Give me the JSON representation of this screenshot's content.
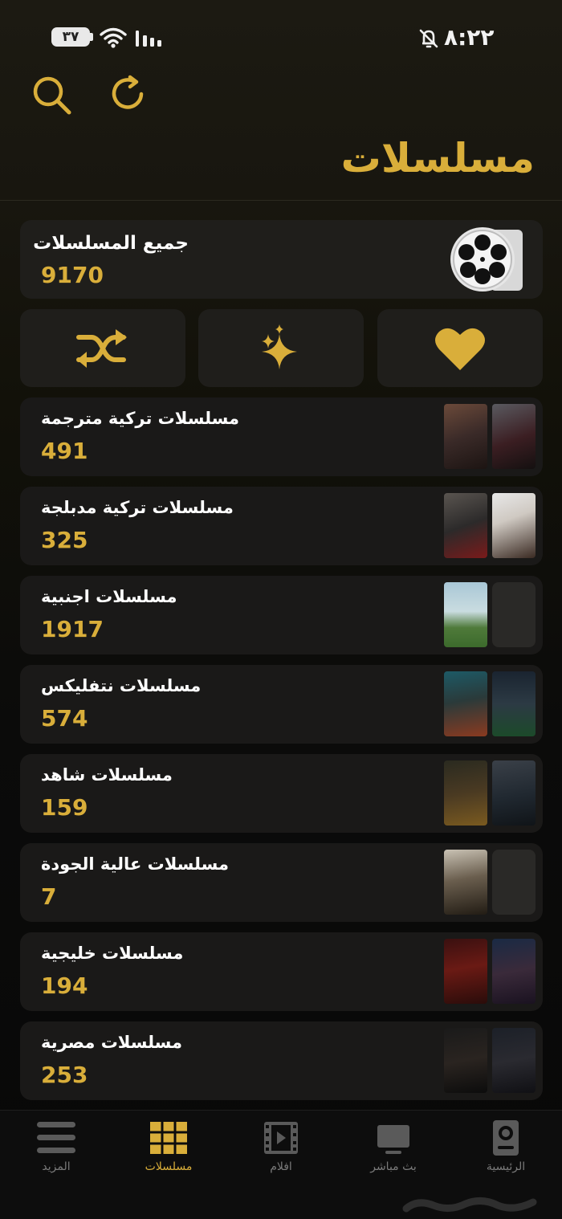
{
  "status_bar": {
    "time": "٨:٢٢",
    "battery": "٣٧"
  },
  "header": {
    "title": "مسلسلات"
  },
  "all_series": {
    "label": "جميع المسلسلات",
    "count": "9170"
  },
  "actions": [
    {
      "name": "shuffle",
      "icon": "shuffle-icon"
    },
    {
      "name": "featured",
      "icon": "sparkles-icon"
    },
    {
      "name": "favorites",
      "icon": "heart-icon"
    }
  ],
  "categories": [
    {
      "label": "مسلسلات تركية مترجمة",
      "count": "491"
    },
    {
      "label": "مسلسلات تركية مدبلجة",
      "count": "325"
    },
    {
      "label": "مسلسلات اجنبية",
      "count": "1917"
    },
    {
      "label": "مسلسلات نتفليكس",
      "count": "574"
    },
    {
      "label": "مسلسلات شاهد",
      "count": "159"
    },
    {
      "label": "مسلسلات عالية الجودة",
      "count": "7"
    },
    {
      "label": "مسلسلات خليجية",
      "count": "194"
    },
    {
      "label": "مسلسلات مصرية",
      "count": "253"
    }
  ],
  "nav": [
    {
      "label": "المزيد",
      "icon": "menu-icon"
    },
    {
      "label": "مسلسلات",
      "icon": "grid-icon",
      "active": true
    },
    {
      "label": "افلام",
      "icon": "film-icon"
    },
    {
      "label": "بث مباشر",
      "icon": "tv-icon"
    },
    {
      "label": "الرئيسية",
      "icon": "home-icon"
    }
  ],
  "colors": {
    "accent": "#d9ae3a",
    "card": "#1f1e1b",
    "background": "#0b0b0a"
  }
}
